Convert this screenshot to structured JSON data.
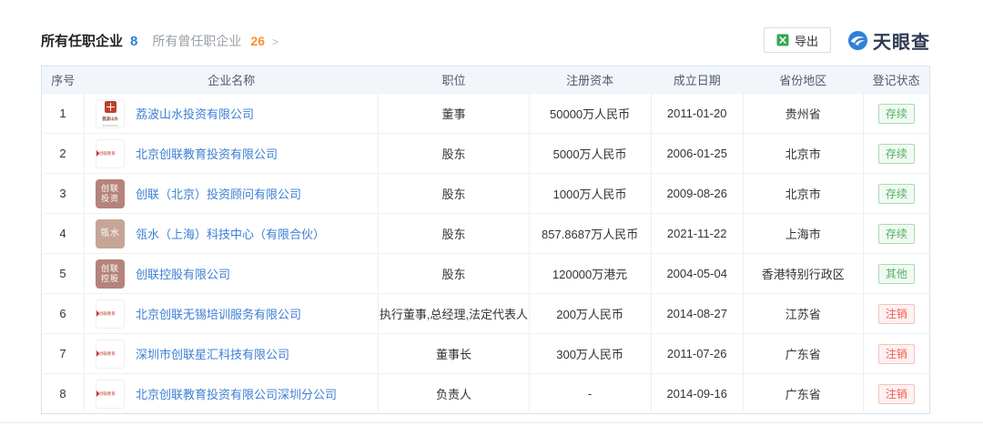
{
  "header": {
    "title": "所有任职企业",
    "title_count": "8",
    "secondary_title": "所有曾任职企业",
    "secondary_count": "26",
    "chevron": ">",
    "export_label": "导出",
    "brand_name": "天眼查"
  },
  "colors": {
    "link_blue": "#3d7fd4",
    "count_blue": "#2b7fd6",
    "count_orange": "#ff8c2b",
    "status_green": "#55b163",
    "status_red": "#f25a50",
    "header_bg": "#f2f6fb",
    "tile_red": "#b5837b",
    "tile_tan": "#c5a595"
  },
  "table": {
    "columns": [
      "序号",
      "企业名称",
      "职位",
      "注册资本",
      "成立日期",
      "省份地区",
      "登记状态"
    ],
    "rows": [
      {
        "no": "1",
        "company": "荔波山水投资有限公司",
        "logo_type": "seal",
        "logo_text": "荔波山水",
        "position": "董事",
        "capital": "50000万人民币",
        "date": "2011-01-20",
        "province": "贵州省",
        "status": "存续",
        "status_type": "green"
      },
      {
        "no": "2",
        "company": "北京创联教育投资有限公司",
        "logo_type": "brand",
        "logo_text": "创联教育",
        "position": "股东",
        "capital": "5000万人民币",
        "date": "2006-01-25",
        "province": "北京市",
        "status": "存续",
        "status_type": "green"
      },
      {
        "no": "3",
        "company": "创联（北京）投资顾问有限公司",
        "logo_type": "tile-red",
        "logo_line1": "创联",
        "logo_line2": "投资",
        "position": "股东",
        "capital": "1000万人民币",
        "date": "2009-08-26",
        "province": "北京市",
        "status": "存续",
        "status_type": "green"
      },
      {
        "no": "4",
        "company": "瓴水（上海）科技中心（有限合伙）",
        "logo_type": "tile-tan",
        "logo_line1": "瓴水",
        "logo_line2": "",
        "position": "股东",
        "capital": "857.8687万人民币",
        "date": "2021-11-22",
        "province": "上海市",
        "status": "存续",
        "status_type": "green"
      },
      {
        "no": "5",
        "company": "创联控股有限公司",
        "logo_type": "tile-red",
        "logo_line1": "创联",
        "logo_line2": "控股",
        "position": "股东",
        "capital": "120000万港元",
        "date": "2004-05-04",
        "province": "香港特别行政区",
        "status": "其他",
        "status_type": "green"
      },
      {
        "no": "6",
        "company": "北京创联无锡培训服务有限公司",
        "logo_type": "brand",
        "logo_text": "创联教育",
        "position": "执行董事,总经理,法定代表人",
        "capital": "200万人民币",
        "date": "2014-08-27",
        "province": "江苏省",
        "status": "注销",
        "status_type": "red"
      },
      {
        "no": "7",
        "company": "深圳市创联星汇科技有限公司",
        "logo_type": "brand",
        "logo_text": "创联教育",
        "position": "董事长",
        "capital": "300万人民币",
        "date": "2011-07-26",
        "province": "广东省",
        "status": "注销",
        "status_type": "red"
      },
      {
        "no": "8",
        "company": "北京创联教育投资有限公司深圳分公司",
        "logo_type": "brand",
        "logo_text": "创联教育",
        "position": "负责人",
        "capital": "-",
        "date": "2014-09-16",
        "province": "广东省",
        "status": "注销",
        "status_type": "red"
      }
    ]
  }
}
